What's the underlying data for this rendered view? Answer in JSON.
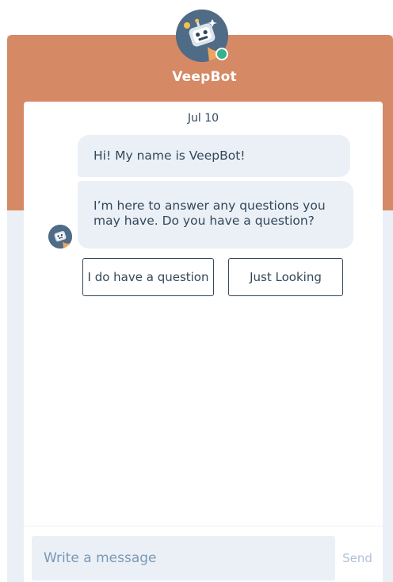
{
  "header": {
    "bot_name": "VeepBot",
    "avatar_icon": "robot-avatar-icon",
    "status": "online",
    "status_color": "#35b18e",
    "band_color": "#d58965"
  },
  "conversation": {
    "date": "Jul 10",
    "messages": [
      {
        "sender": "bot",
        "text": "Hi! My name is VeepBot!"
      },
      {
        "sender": "bot",
        "text": "I’m here to answer any questions you may have. Do you have a question?"
      }
    ],
    "quick_replies": [
      "I do have a question",
      "Just Looking"
    ]
  },
  "composer": {
    "placeholder": "Write a message",
    "send_label": "Send"
  }
}
